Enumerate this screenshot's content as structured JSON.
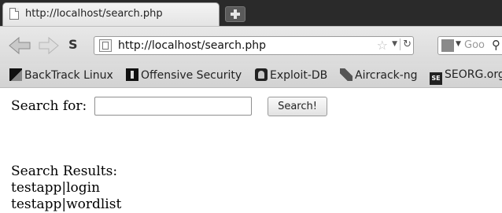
{
  "browser": {
    "tab": {
      "title": "http://localhost/search.php"
    },
    "address_bar": {
      "url": "http://localhost/search.php"
    },
    "search_box": {
      "placeholder": "Goo"
    },
    "nav": {
      "s_label": "S"
    },
    "bookmarks": [
      {
        "label": "BackTrack Linux"
      },
      {
        "label": "Offensive Security"
      },
      {
        "label": "Exploit-DB"
      },
      {
        "label": "Aircrack-ng"
      },
      {
        "label": "SEORG.org",
        "icon_text": "SE"
      }
    ]
  },
  "page": {
    "search_label": "Search for:",
    "search_value": "",
    "search_button": "Search!",
    "results_heading": "Search Results:",
    "results": [
      "testapp|login",
      "testapp|wordlist"
    ]
  }
}
